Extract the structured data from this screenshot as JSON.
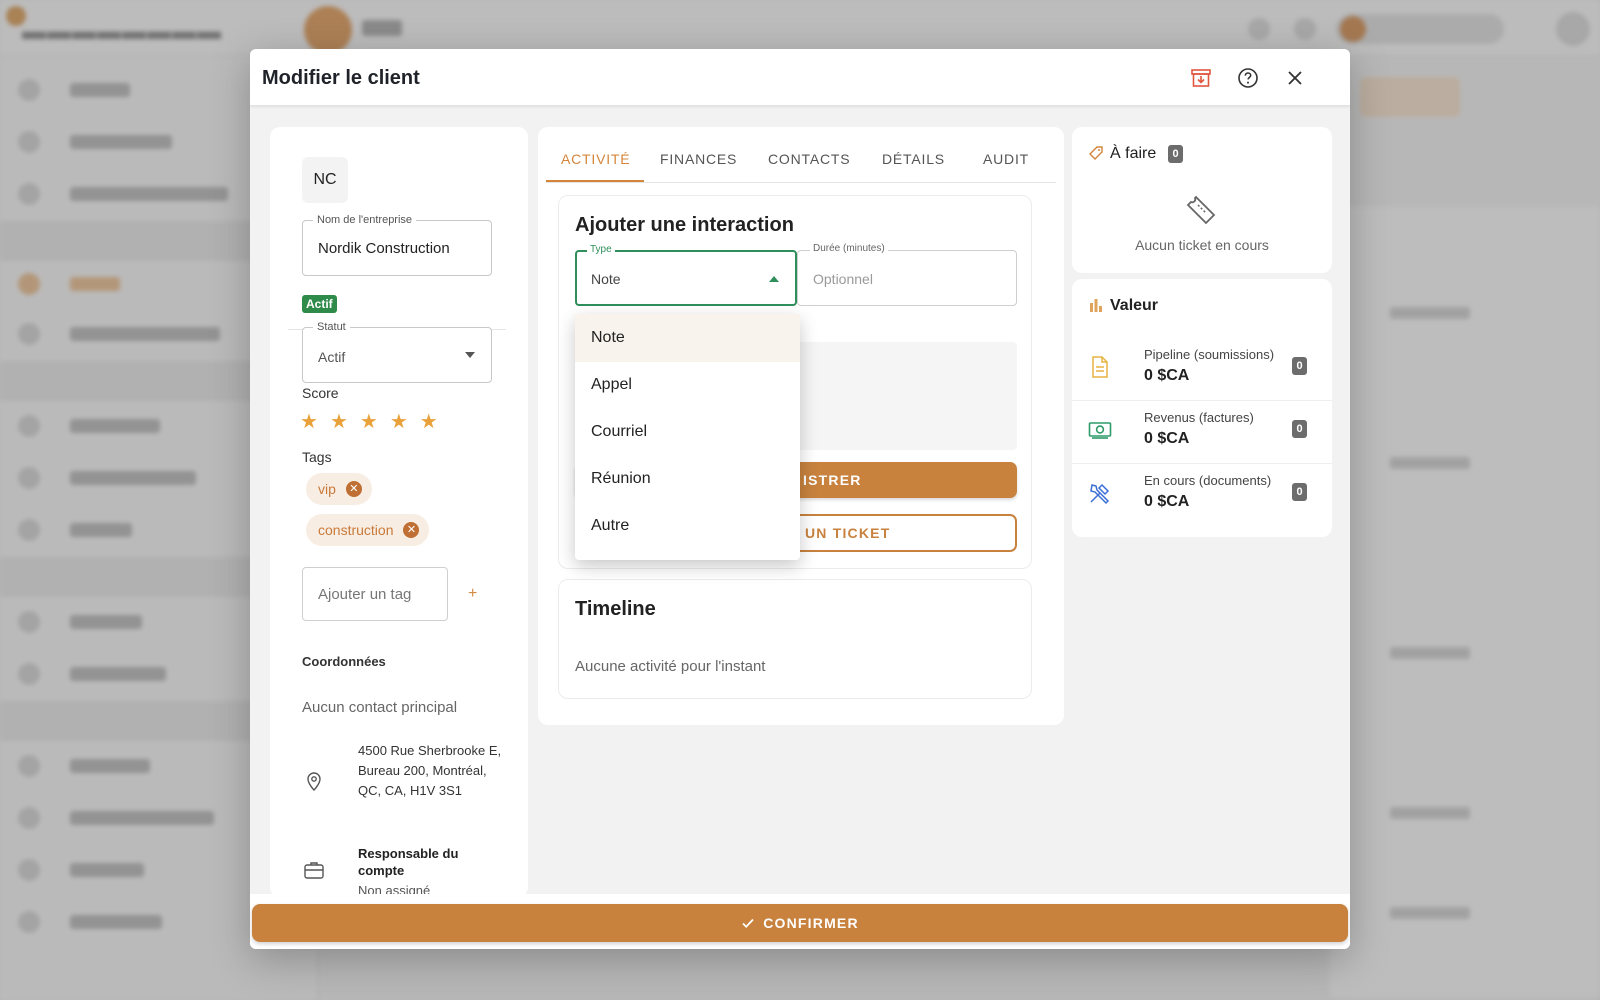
{
  "colors": {
    "accent": "#c8823e",
    "active_tab": "#d4853a",
    "success": "#2e8b4a",
    "focus": "#2f8f5b"
  },
  "modal": {
    "title": "Modifier le client",
    "header_icons": [
      "archive-icon",
      "help-icon",
      "close-icon"
    ],
    "confirm_label": "CONFIRMER"
  },
  "client": {
    "initials": "NC",
    "company_label": "Nom de l'entreprise",
    "company_name": "Nordik Construction",
    "active_chip": "Actif",
    "status_label": "Statut",
    "status_value": "Actif",
    "score_label": "Score",
    "score": 5,
    "stars": [
      "★",
      "★",
      "★",
      "★",
      "★"
    ],
    "tags_label": "Tags",
    "tags": [
      "vip",
      "construction"
    ],
    "add_tag_placeholder": "Ajouter un tag",
    "add_tag_symbol": "+",
    "coords_label": "Coordonnées",
    "no_primary_contact": "Aucun contact principal",
    "address": "4500 Rue Sherbrooke E, Bureau 200, Montréal, QC, CA, H1V 3S1",
    "account_manager_label": "Responsable du compte",
    "account_manager_value": "Non assigné"
  },
  "tabs": [
    "ACTIVITÉ",
    "FINANCES",
    "CONTACTS",
    "DÉTAILS",
    "AUDIT"
  ],
  "interaction": {
    "title": "Ajouter une interaction",
    "type_label": "Type",
    "type_value": "Note",
    "duration_label": "Durée (minutes)",
    "duration_placeholder": "Optionnel",
    "save_button_visible": "ISTRER",
    "ticket_button_visible": "UN TICKET",
    "type_options": [
      "Note",
      "Appel",
      "Courriel",
      "Réunion",
      "Autre"
    ]
  },
  "timeline": {
    "title": "Timeline",
    "empty": "Aucune activité pour l'instant"
  },
  "todo": {
    "title": "À faire",
    "count": "0",
    "empty": "Aucun ticket en cours"
  },
  "value": {
    "title": "Valeur",
    "rows": [
      {
        "label": "Pipeline (soumissions)",
        "amount": "0 $CA",
        "count": "0",
        "icon": "document-icon"
      },
      {
        "label": "Revenus (factures)",
        "amount": "0 $CA",
        "count": "0",
        "icon": "money-icon"
      },
      {
        "label": "En cours (documents)",
        "amount": "0 $CA",
        "count": "0",
        "icon": "tools-icon"
      }
    ]
  }
}
